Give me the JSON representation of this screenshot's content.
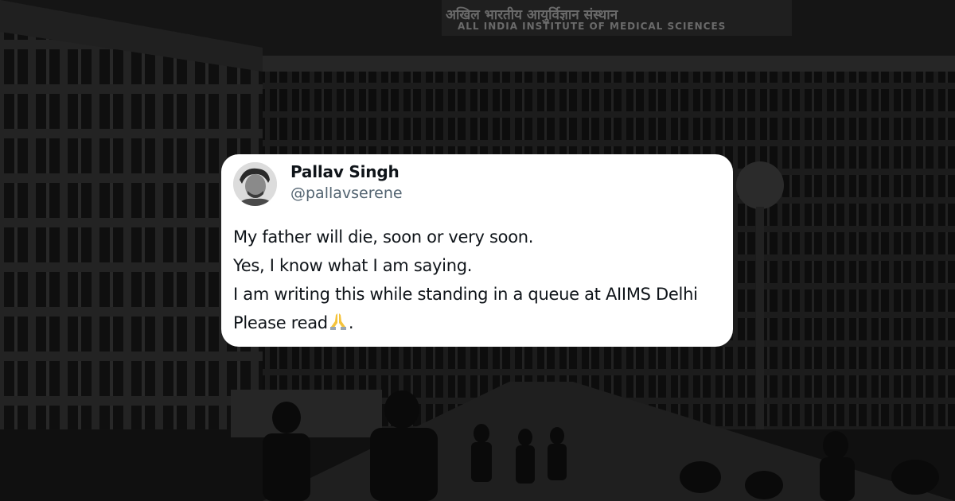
{
  "background": {
    "signboard_line_1": "अखिल भारतीय आयुर्विज्ञान संस्थान",
    "signboard_line_2": "ALL INDIA INSTITUTE OF MEDICAL SCIENCES"
  },
  "tweet": {
    "author": {
      "display_name": "Pallav Singh",
      "handle": "@pallavserene"
    },
    "lines": [
      "My father will die, soon or very soon.",
      "Yes, I know what I am saying.",
      "I am writing this while standing in a queue at AIIMS Delhi",
      "Please read"
    ],
    "last_line_suffix": ".",
    "emoji": "folded-hands-icon"
  },
  "colors": {
    "card_background": "#ffffff",
    "name_text": "#0f1419",
    "handle_text": "#536471",
    "photo_overlay": "#1b1b1b"
  }
}
